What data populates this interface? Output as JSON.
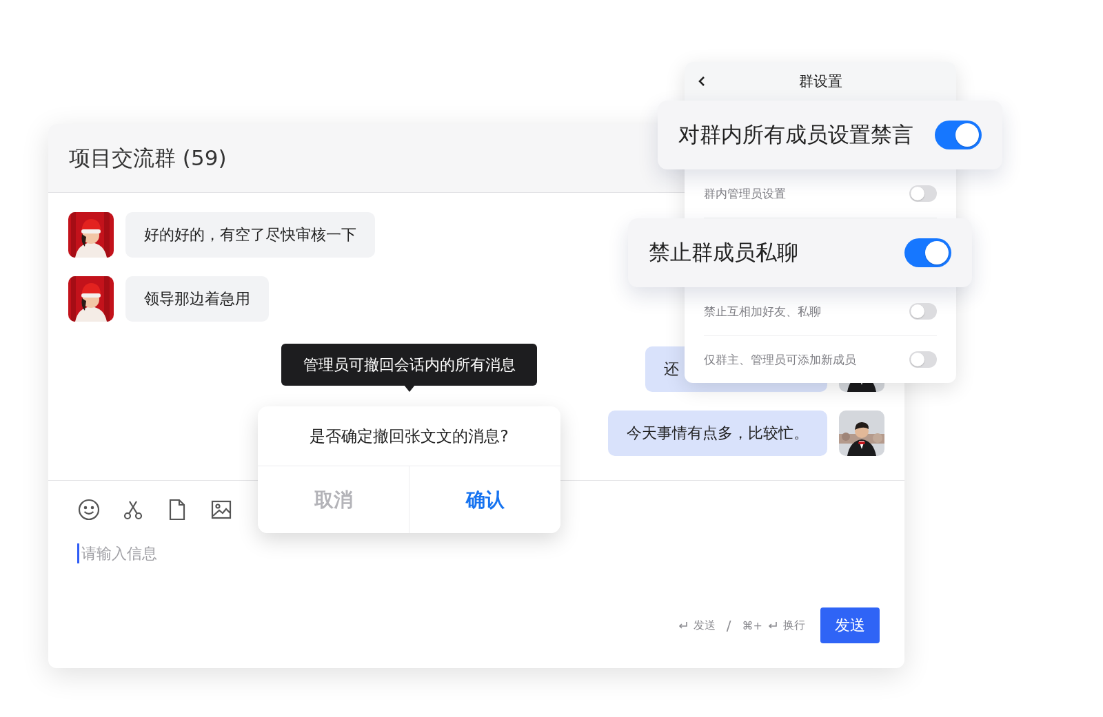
{
  "chat": {
    "title": "项目交流群 (59)",
    "messages": [
      {
        "kind": "incoming",
        "text": "好的好的，有空了尽快审核一下"
      },
      {
        "kind": "incoming",
        "text": "领导那边着急用"
      },
      {
        "kind": "outgoing",
        "text": "还"
      },
      {
        "kind": "outgoing",
        "text": "今天事情有点多，比较忙。"
      }
    ],
    "input": {
      "placeholder": "请输入信息"
    },
    "hint": {
      "send_key": "发送",
      "separator": "/",
      "modifier": "⌘+",
      "newline_key": "换行"
    },
    "send_button": "发送"
  },
  "tooltip": "管理员可撤回会话内的所有消息",
  "dialog": {
    "question": "是否确定撤回张文文的消息?",
    "cancel": "取消",
    "confirm": "确认"
  },
  "settings": {
    "title": "群设置",
    "items": [
      {
        "kind": "featured",
        "label": "对群内所有成员设置禁言",
        "on": true
      },
      {
        "kind": "row",
        "label": "群内管理员设置",
        "on": false
      },
      {
        "kind": "featured",
        "label": "禁止群成员私聊",
        "on": true
      },
      {
        "kind": "row",
        "label": "禁止互相加好友、私聊",
        "on": false
      },
      {
        "kind": "row",
        "label": "仅群主、管理员可添加新成员",
        "on": false
      }
    ]
  }
}
